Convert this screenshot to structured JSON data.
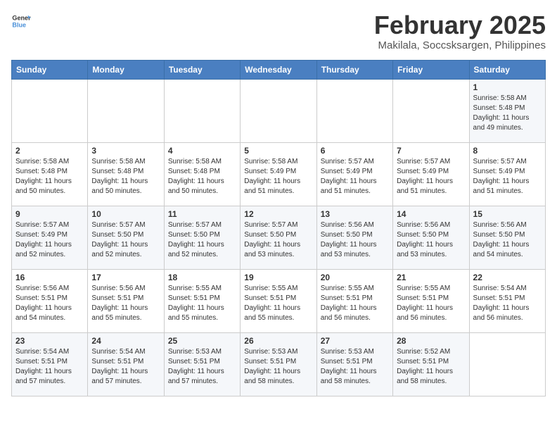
{
  "header": {
    "logo_line1": "General",
    "logo_line2": "Blue",
    "title": "February 2025",
    "subtitle": "Makilala, Soccsksargen, Philippines"
  },
  "weekdays": [
    "Sunday",
    "Monday",
    "Tuesday",
    "Wednesday",
    "Thursday",
    "Friday",
    "Saturday"
  ],
  "weeks": [
    [
      {
        "day": "",
        "info": ""
      },
      {
        "day": "",
        "info": ""
      },
      {
        "day": "",
        "info": ""
      },
      {
        "day": "",
        "info": ""
      },
      {
        "day": "",
        "info": ""
      },
      {
        "day": "",
        "info": ""
      },
      {
        "day": "1",
        "info": "Sunrise: 5:58 AM\nSunset: 5:48 PM\nDaylight: 11 hours\nand 49 minutes."
      }
    ],
    [
      {
        "day": "2",
        "info": "Sunrise: 5:58 AM\nSunset: 5:48 PM\nDaylight: 11 hours\nand 50 minutes."
      },
      {
        "day": "3",
        "info": "Sunrise: 5:58 AM\nSunset: 5:48 PM\nDaylight: 11 hours\nand 50 minutes."
      },
      {
        "day": "4",
        "info": "Sunrise: 5:58 AM\nSunset: 5:48 PM\nDaylight: 11 hours\nand 50 minutes."
      },
      {
        "day": "5",
        "info": "Sunrise: 5:58 AM\nSunset: 5:49 PM\nDaylight: 11 hours\nand 51 minutes."
      },
      {
        "day": "6",
        "info": "Sunrise: 5:57 AM\nSunset: 5:49 PM\nDaylight: 11 hours\nand 51 minutes."
      },
      {
        "day": "7",
        "info": "Sunrise: 5:57 AM\nSunset: 5:49 PM\nDaylight: 11 hours\nand 51 minutes."
      },
      {
        "day": "8",
        "info": "Sunrise: 5:57 AM\nSunset: 5:49 PM\nDaylight: 11 hours\nand 51 minutes."
      }
    ],
    [
      {
        "day": "9",
        "info": "Sunrise: 5:57 AM\nSunset: 5:49 PM\nDaylight: 11 hours\nand 52 minutes."
      },
      {
        "day": "10",
        "info": "Sunrise: 5:57 AM\nSunset: 5:50 PM\nDaylight: 11 hours\nand 52 minutes."
      },
      {
        "day": "11",
        "info": "Sunrise: 5:57 AM\nSunset: 5:50 PM\nDaylight: 11 hours\nand 52 minutes."
      },
      {
        "day": "12",
        "info": "Sunrise: 5:57 AM\nSunset: 5:50 PM\nDaylight: 11 hours\nand 53 minutes."
      },
      {
        "day": "13",
        "info": "Sunrise: 5:56 AM\nSunset: 5:50 PM\nDaylight: 11 hours\nand 53 minutes."
      },
      {
        "day": "14",
        "info": "Sunrise: 5:56 AM\nSunset: 5:50 PM\nDaylight: 11 hours\nand 53 minutes."
      },
      {
        "day": "15",
        "info": "Sunrise: 5:56 AM\nSunset: 5:50 PM\nDaylight: 11 hours\nand 54 minutes."
      }
    ],
    [
      {
        "day": "16",
        "info": "Sunrise: 5:56 AM\nSunset: 5:51 PM\nDaylight: 11 hours\nand 54 minutes."
      },
      {
        "day": "17",
        "info": "Sunrise: 5:56 AM\nSunset: 5:51 PM\nDaylight: 11 hours\nand 55 minutes."
      },
      {
        "day": "18",
        "info": "Sunrise: 5:55 AM\nSunset: 5:51 PM\nDaylight: 11 hours\nand 55 minutes."
      },
      {
        "day": "19",
        "info": "Sunrise: 5:55 AM\nSunset: 5:51 PM\nDaylight: 11 hours\nand 55 minutes."
      },
      {
        "day": "20",
        "info": "Sunrise: 5:55 AM\nSunset: 5:51 PM\nDaylight: 11 hours\nand 56 minutes."
      },
      {
        "day": "21",
        "info": "Sunrise: 5:55 AM\nSunset: 5:51 PM\nDaylight: 11 hours\nand 56 minutes."
      },
      {
        "day": "22",
        "info": "Sunrise: 5:54 AM\nSunset: 5:51 PM\nDaylight: 11 hours\nand 56 minutes."
      }
    ],
    [
      {
        "day": "23",
        "info": "Sunrise: 5:54 AM\nSunset: 5:51 PM\nDaylight: 11 hours\nand 57 minutes."
      },
      {
        "day": "24",
        "info": "Sunrise: 5:54 AM\nSunset: 5:51 PM\nDaylight: 11 hours\nand 57 minutes."
      },
      {
        "day": "25",
        "info": "Sunrise: 5:53 AM\nSunset: 5:51 PM\nDaylight: 11 hours\nand 57 minutes."
      },
      {
        "day": "26",
        "info": "Sunrise: 5:53 AM\nSunset: 5:51 PM\nDaylight: 11 hours\nand 58 minutes."
      },
      {
        "day": "27",
        "info": "Sunrise: 5:53 AM\nSunset: 5:51 PM\nDaylight: 11 hours\nand 58 minutes."
      },
      {
        "day": "28",
        "info": "Sunrise: 5:52 AM\nSunset: 5:51 PM\nDaylight: 11 hours\nand 58 minutes."
      },
      {
        "day": "",
        "info": ""
      }
    ]
  ]
}
